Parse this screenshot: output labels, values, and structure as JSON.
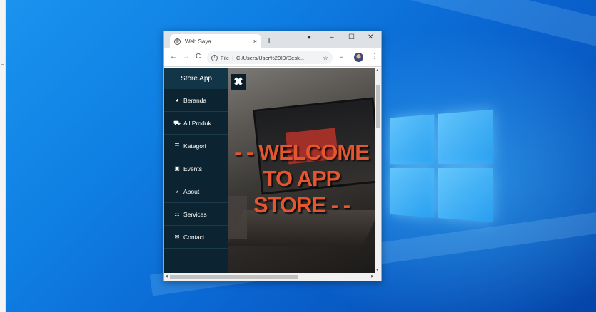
{
  "browser": {
    "tab_title": "Web Saya",
    "tab_close": "×",
    "new_tab": "+",
    "minimize": "–",
    "maximize": "☐",
    "close": "✕",
    "back": "←",
    "forward": "→",
    "reload": "C",
    "url_scheme": "File",
    "url": "C:/Users/User%20ID/Desk..."
  },
  "sidebar": {
    "title": "Store App",
    "items": [
      {
        "label": "Beranda",
        "icon": "dashboard-icon"
      },
      {
        "label": "All Produk",
        "icon": "cart-icon"
      },
      {
        "label": "Kategori",
        "icon": "list-icon"
      },
      {
        "label": "Events",
        "icon": "calendar-icon"
      },
      {
        "label": "About",
        "icon": "question-icon"
      },
      {
        "label": "Services",
        "icon": "sliders-icon"
      },
      {
        "label": "Contact",
        "icon": "envelope-icon"
      }
    ]
  },
  "hero": {
    "close_symbol": "✖",
    "headline": "- - WELCOME TO APP STORE - -",
    "accent_color": "#e3562f"
  },
  "colors": {
    "sidebar_bg": "#0c2431",
    "desktop_blue": "#0f7fe3"
  }
}
